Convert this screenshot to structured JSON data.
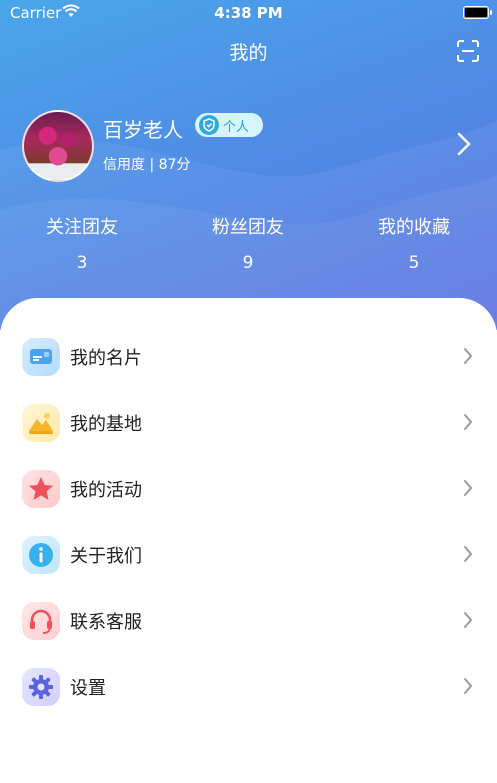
{
  "status_bar": {
    "carrier": "Carrier",
    "time": "4:38 PM"
  },
  "header": {
    "title": "我的"
  },
  "profile": {
    "name": "百岁老人",
    "badge": "个人",
    "credit": "信用度 | 87分"
  },
  "stats": [
    {
      "label": "关注团友",
      "value": "3"
    },
    {
      "label": "粉丝团友",
      "value": "9"
    },
    {
      "label": "我的收藏",
      "value": "5"
    }
  ],
  "menu": [
    {
      "label": "我的名片",
      "icon": "card-icon"
    },
    {
      "label": "我的基地",
      "icon": "base-icon"
    },
    {
      "label": "我的活动",
      "icon": "star-icon"
    },
    {
      "label": "关于我们",
      "icon": "info-icon"
    },
    {
      "label": "联系客服",
      "icon": "headset-icon"
    },
    {
      "label": "设置",
      "icon": "gear-icon"
    }
  ]
}
